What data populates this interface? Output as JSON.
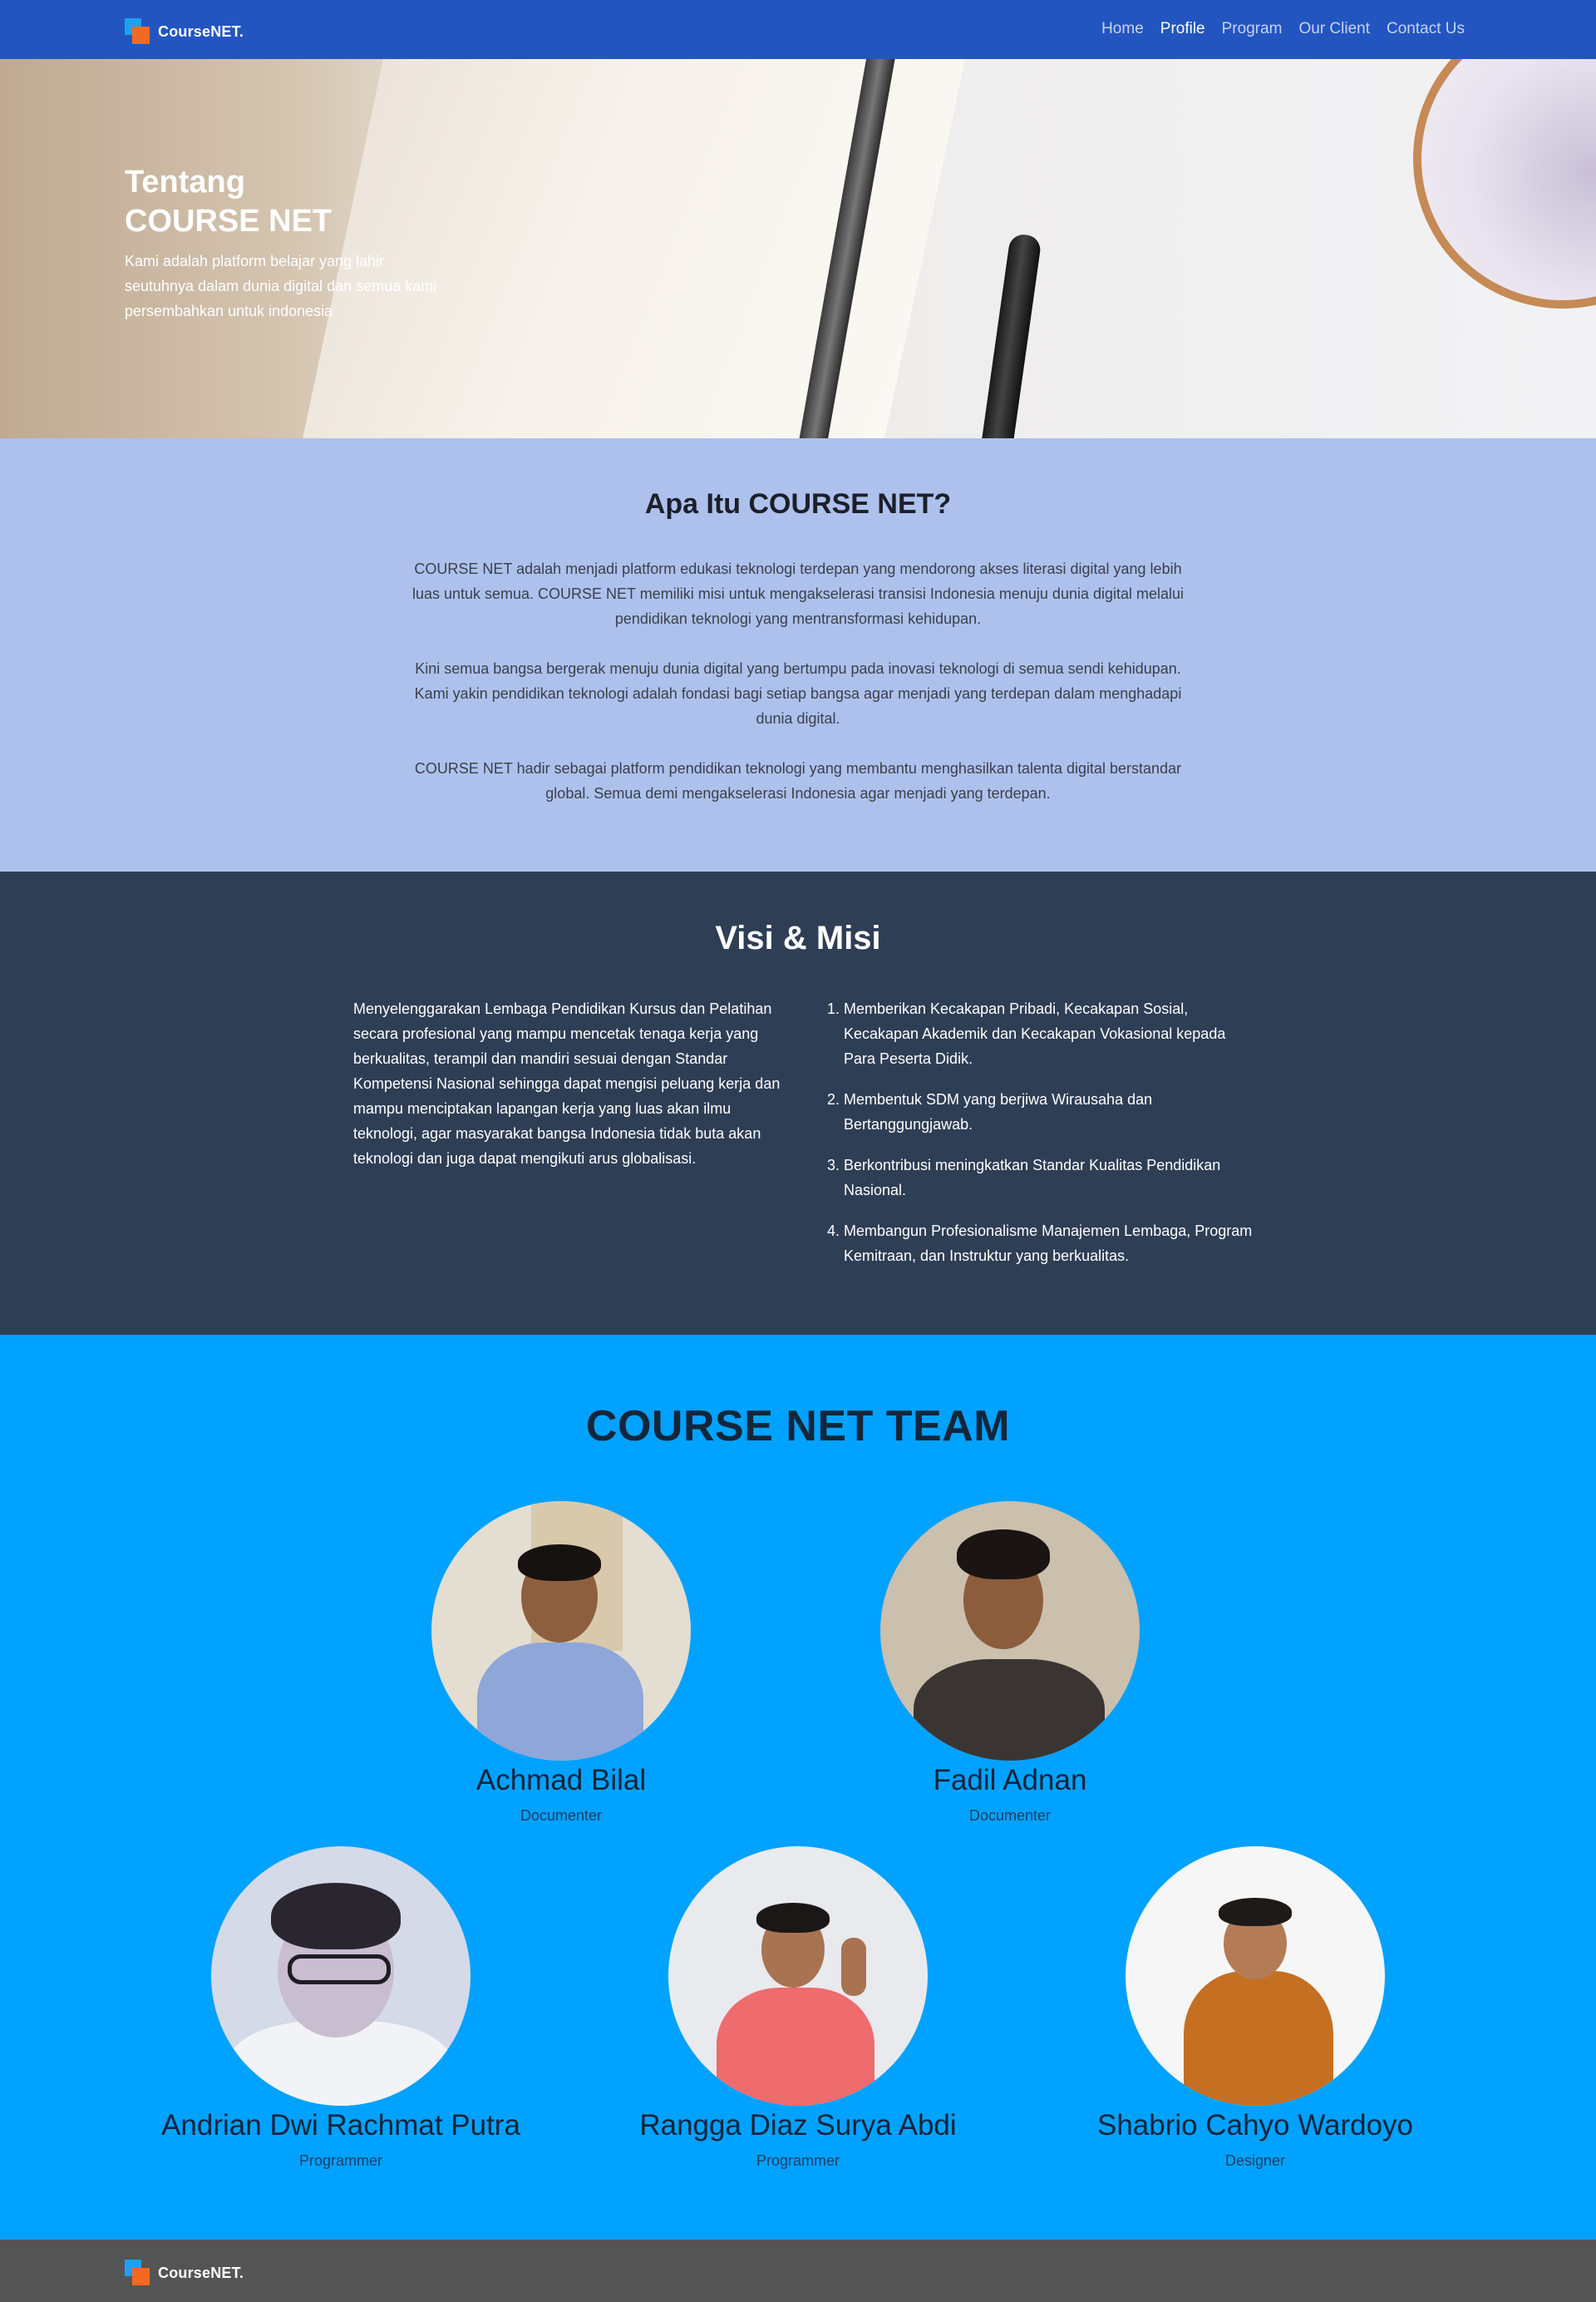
{
  "navbar": {
    "brand": "CourseNET.",
    "links": [
      "Home",
      "Profile",
      "Program",
      "Our Client",
      "Contact Us"
    ],
    "active": "Profile"
  },
  "hero": {
    "title_line1": "Tentang",
    "title_line2": "COURSE NET",
    "text": "Kami adalah platform belajar yang lahir seutuhnya dalam dunia digital dan semua kami persembahkan untuk indonesia"
  },
  "about": {
    "heading": "Apa Itu COURSE NET?",
    "paragraphs": [
      "COURSE NET adalah menjadi platform edukasi teknologi terdepan yang mendorong akses literasi digital yang lebih luas untuk semua. COURSE NET memiliki misi untuk mengakselerasi transisi Indonesia menuju dunia digital melalui pendidikan teknologi yang mentransformasi kehidupan.",
      "Kini semua bangsa bergerak menuju dunia digital yang bertumpu pada inovasi teknologi di semua sendi kehidupan. Kami yakin pendidikan teknologi adalah fondasi bagi setiap bangsa agar menjadi yang terdepan dalam menghadapi dunia digital.",
      "COURSE NET hadir sebagai platform pendidikan teknologi yang membantu menghasilkan talenta digital berstandar global. Semua demi mengakselerasi Indonesia agar menjadi yang terdepan."
    ]
  },
  "visi_misi": {
    "heading": "Visi & Misi",
    "visi": "Menyelenggarakan Lembaga Pendidikan Kursus dan Pelatihan secara profesional yang mampu mencetak tenaga kerja yang berkualitas, terampil dan mandiri sesuai dengan Standar Kompetensi Nasional sehingga dapat mengisi peluang kerja dan mampu menciptakan lapangan kerja yang luas akan ilmu teknologi, agar masyarakat bangsa Indonesia tidak buta akan teknologi dan juga dapat mengikuti arus globalisasi.",
    "misi": [
      {
        "num": "1.",
        "text": "Memberikan Kecakapan Pribadi, Kecakapan Sosial, Kecakapan Akademik dan Kecakapan Vokasional kepada Para Peserta Didik."
      },
      {
        "num": "2.",
        "text": "Membentuk SDM yang berjiwa Wirausaha dan Bertanggungjawab."
      },
      {
        "num": "3.",
        "text": "Berkontribusi meningkatkan Standar Kualitas Pendidikan Nasional."
      },
      {
        "num": "4.",
        "text": "Membangun Profesionalisme Manajemen Lembaga, Program Kemitraan, dan Instruktur yang berkualitas."
      }
    ]
  },
  "team": {
    "heading": "COURSE NET TEAM",
    "members": [
      {
        "name": "Achmad Bilal",
        "role": "Documenter"
      },
      {
        "name": "Fadil Adnan",
        "role": "Documenter"
      },
      {
        "name": "Andrian Dwi Rachmat Putra",
        "role": "Programmer"
      },
      {
        "name": "Rangga Diaz Surya Abdi",
        "role": "Programmer"
      },
      {
        "name": "Shabrio Cahyo Wardoyo",
        "role": "Designer"
      }
    ]
  },
  "footer": {
    "brand": "CourseNET."
  }
}
